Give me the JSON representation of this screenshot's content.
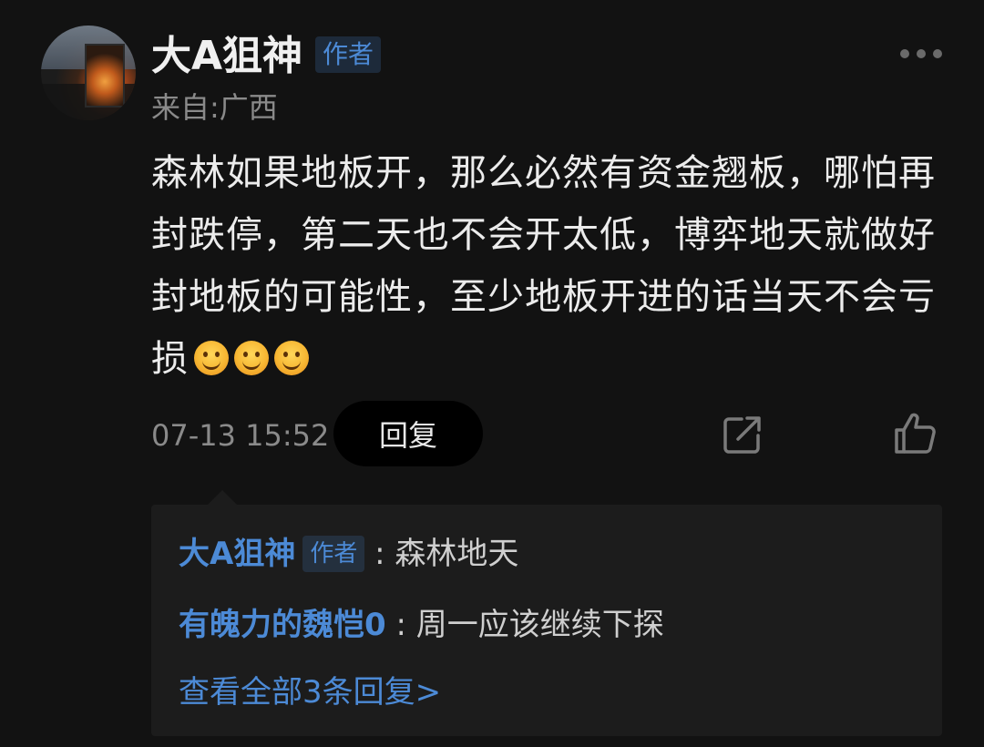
{
  "comment": {
    "author": "大A狙神",
    "author_badge": "作者",
    "location": "来自:广西",
    "body": "森林如果地板开，那么必然有资金翘板，哪怕再封跌停，第二天也不会开太低，博弈地天就做好封地板的可能性，至少地板开进的话当天不会亏损",
    "emoji_icons": [
      "smile-emoji",
      "smile-emoji",
      "smile-emoji"
    ],
    "timestamp": "07-13 15:52",
    "reply_label": "回复"
  },
  "replies": {
    "items": [
      {
        "name": "大A狙神",
        "badge": "作者",
        "text": ": 森林地天"
      },
      {
        "name": "有魄力的魏恺0",
        "badge": "",
        "text": ": 周一应该继续下探"
      }
    ],
    "view_all": "查看全部3条回复>"
  },
  "icons": {
    "more": "more-dots-icon",
    "share": "share-icon",
    "like": "thumbs-up-icon"
  },
  "colors": {
    "background": "#121212",
    "accent": "#4c8ad6",
    "badge_bg": "#1d2a3a",
    "reply_panel": "#1c1c1c"
  }
}
